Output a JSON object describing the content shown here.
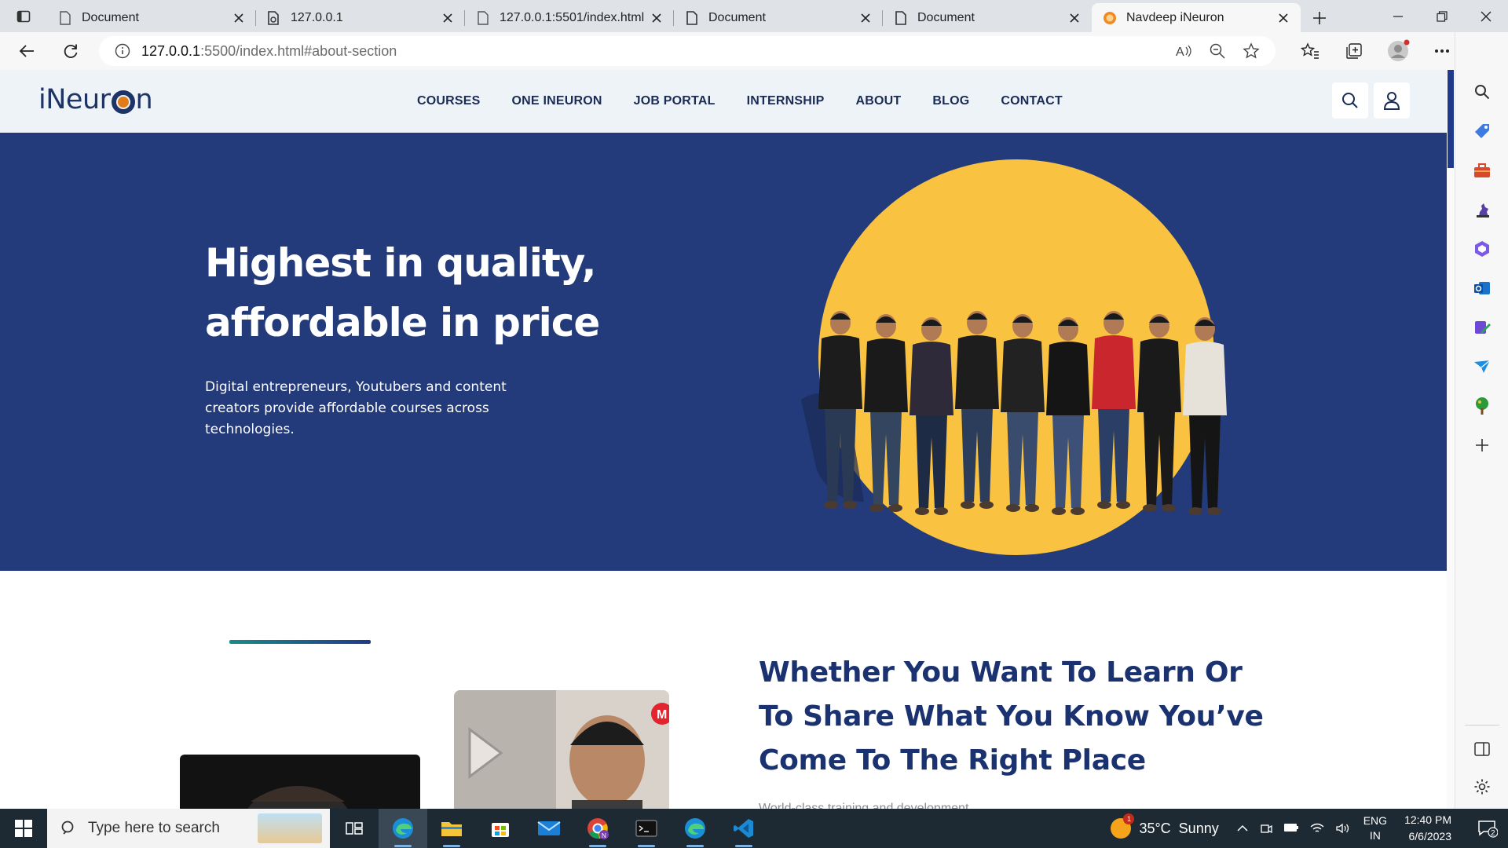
{
  "browser": {
    "tabs": [
      {
        "title": "Document",
        "icon": "page-icon",
        "active": false
      },
      {
        "title": "127.0.0.1",
        "icon": "page-sync-icon",
        "active": false
      },
      {
        "title": "127.0.0.1:5501/index.html",
        "icon": "page-icon",
        "active": false
      },
      {
        "title": "Document",
        "icon": "page-icon",
        "active": false
      },
      {
        "title": "Document",
        "icon": "page-icon",
        "active": false
      },
      {
        "title": "Navdeep iNeuron",
        "icon": "ineuron-favicon",
        "active": true
      }
    ],
    "url_host": "127.0.0.1",
    "url_path": ":5500/index.html#about-section"
  },
  "site": {
    "logo_text_before": "iNeur",
    "logo_text_after": "n",
    "nav": [
      "COURSES",
      "ONE INEURON",
      "JOB PORTAL",
      "INTERNSHIP",
      "ABOUT",
      "BLOG",
      "CONTACT"
    ]
  },
  "hero": {
    "title_line1": "Highest in quality,",
    "title_line2": "affordable in price",
    "description": "Digital entrepreneurs, Youtubers and content creators provide affordable courses across technologies."
  },
  "about": {
    "title": "Whether You Want To Learn Or To Share What You Know You’ve Come To The Right Place",
    "subtitle": "World-class training and development"
  },
  "taskbar": {
    "search_placeholder": "Type here to search",
    "weather_temp": "35°C",
    "weather_text": "Sunny",
    "weather_badge": "1",
    "lang_line1": "ENG",
    "lang_line2": "IN",
    "time": "12:40 PM",
    "date": "6/6/2023",
    "notif_count": "2"
  },
  "colors": {
    "hero_bg": "#233a7b",
    "hero_circle": "#f9c240",
    "brand_navy": "#1b3270",
    "header_bg": "#eef3f8"
  }
}
